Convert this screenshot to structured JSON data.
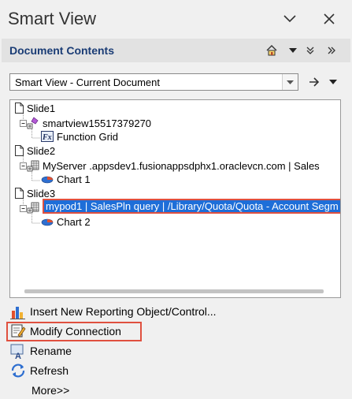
{
  "pane": {
    "title": "Smart View"
  },
  "section": {
    "title": "Document Contents"
  },
  "document_select": {
    "value": "Smart View - Current Document"
  },
  "tree": {
    "slide1": "Slide1",
    "smartview_conn": "smartview15517379270",
    "function_grid": "Function Grid",
    "slide2": "Slide2",
    "myserver_conn": "MyServer .appsdev1.fusionappsdphx1.oraclevcn.com | Sales",
    "chart1": "Chart 1",
    "slide3": "Slide3",
    "mypod_conn": "mypod1 | SalesPln query | /Library/Quota/Quota - Account Segm",
    "chart2": "Chart 2"
  },
  "actions": {
    "insert": "Insert New Reporting Object/Control...",
    "modify": "Modify Connection",
    "rename": "Rename",
    "refresh": "Refresh",
    "more": "More>>"
  },
  "colors": {
    "title_text": "#333333",
    "section_title": "#1a3c75",
    "selection_bg": "#1e6ed8",
    "highlight_border": "#e0503f"
  }
}
